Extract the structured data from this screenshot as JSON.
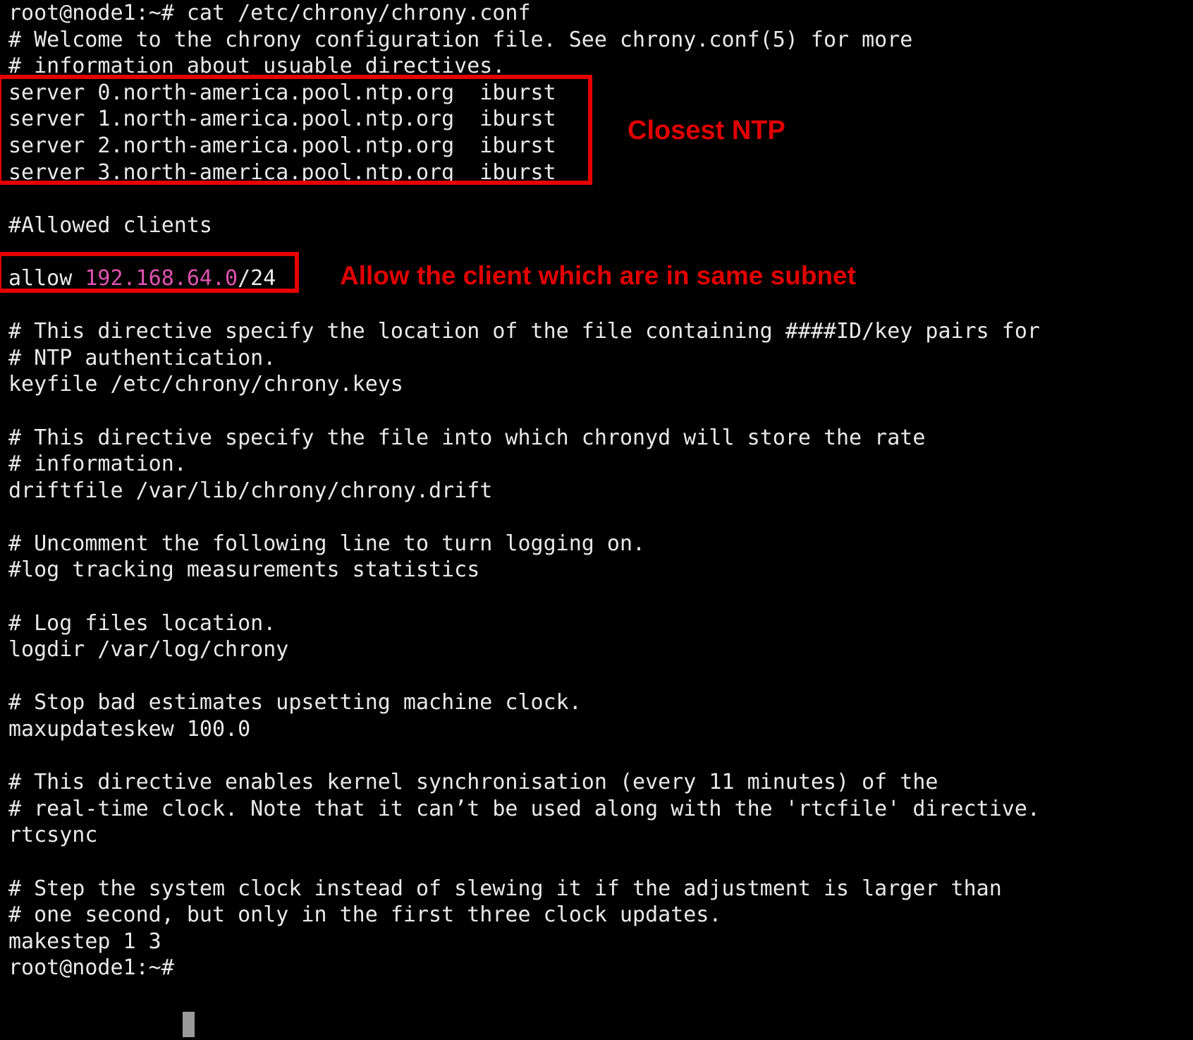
{
  "terminal": {
    "prompt_command": "root@node1:~# cat /etc/chrony/chrony.conf",
    "final_prompt": "root@node1:~#",
    "cursor": "block-cursor",
    "colors": {
      "background": "#000000",
      "foreground": "#e9e9e9",
      "ip_highlight": "#e052b0",
      "annotation_red": "#e10000",
      "box_red": "#e60000",
      "cursor": "#9a9a9a"
    },
    "lines": [
      {
        "id": "l0",
        "text": "root@node1:~# cat /etc/chrony/chrony.conf"
      },
      {
        "id": "l1",
        "text": "# Welcome to the chrony configuration file. See chrony.conf(5) for more"
      },
      {
        "id": "l2",
        "text": "# information about usuable directives."
      },
      {
        "id": "l3",
        "text": "server 0.north-america.pool.ntp.org  iburst"
      },
      {
        "id": "l4",
        "text": "server 1.north-america.pool.ntp.org  iburst"
      },
      {
        "id": "l5",
        "text": "server 2.north-america.pool.ntp.org  iburst"
      },
      {
        "id": "l6",
        "text": "server 3.north-america.pool.ntp.org  iburst"
      },
      {
        "id": "l7",
        "text": ""
      },
      {
        "id": "l8",
        "text": "#Allowed clients"
      },
      {
        "id": "l9",
        "text": ""
      },
      {
        "id": "l10",
        "text": ""
      },
      {
        "id": "l11",
        "text": ""
      },
      {
        "id": "l12",
        "text": "# This directive specify the location of the file containing ####ID/key pairs for"
      },
      {
        "id": "l13",
        "text": "# NTP authentication."
      },
      {
        "id": "l14",
        "text": "keyfile /etc/chrony/chrony.keys"
      },
      {
        "id": "l15",
        "text": ""
      },
      {
        "id": "l16",
        "text": "# This directive specify the file into which chronyd will store the rate"
      },
      {
        "id": "l17",
        "text": "# information."
      },
      {
        "id": "l18",
        "text": "driftfile /var/lib/chrony/chrony.drift"
      },
      {
        "id": "l19",
        "text": ""
      },
      {
        "id": "l20",
        "text": "# Uncomment the following line to turn logging on."
      },
      {
        "id": "l21",
        "text": "#log tracking measurements statistics"
      },
      {
        "id": "l22",
        "text": ""
      },
      {
        "id": "l23",
        "text": "# Log files location."
      },
      {
        "id": "l24",
        "text": "logdir /var/log/chrony"
      },
      {
        "id": "l25",
        "text": ""
      },
      {
        "id": "l26",
        "text": "# Stop bad estimates upsetting machine clock."
      },
      {
        "id": "l27",
        "text": "maxupdateskew 100.0"
      },
      {
        "id": "l28",
        "text": ""
      },
      {
        "id": "l29",
        "text": "# This directive enables kernel synchronisation (every 11 minutes) of the"
      },
      {
        "id": "l30",
        "text": "# real-time clock. Note that it can’t be used along with the 'rtcfile' directive."
      },
      {
        "id": "l31",
        "text": "rtcsync"
      },
      {
        "id": "l32",
        "text": ""
      },
      {
        "id": "l33",
        "text": "# Step the system clock instead of slewing it if the adjustment is larger than"
      },
      {
        "id": "l34",
        "text": "# one second, but only in the first three clock updates."
      },
      {
        "id": "l35",
        "text": "makestep 1 3"
      },
      {
        "id": "l36",
        "text": "root@node1:~#"
      }
    ],
    "allow_line": {
      "directive": "allow ",
      "ip": "192.168.64.0",
      "prefix": "/24"
    }
  },
  "annotations": [
    {
      "id": "closest-ntp",
      "text": "Closest NTP"
    },
    {
      "id": "allow-subnet",
      "text": "Allow the client which are in same subnet"
    }
  ]
}
